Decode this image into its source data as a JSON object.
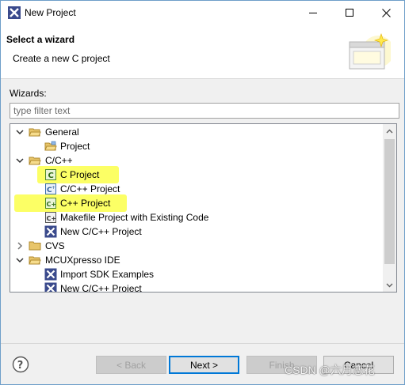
{
  "window": {
    "title": "New Project",
    "controls": [
      "minimize",
      "maximize",
      "close"
    ]
  },
  "banner": {
    "title": "Select a wizard",
    "subtitle": "Create a new C project"
  },
  "wizards": {
    "label": "Wizards:",
    "filter_placeholder": "type filter text",
    "filter_value": "",
    "tree": [
      {
        "label": "General",
        "icon": "folder-open-icon",
        "expanded": true
      },
      {
        "label": "Project",
        "icon": "project-folder-icon"
      },
      {
        "label": "C/C++",
        "icon": "folder-open-icon",
        "expanded": true
      },
      {
        "label": "C Project",
        "icon": "c-project-icon",
        "highlighted": true
      },
      {
        "label": "C/C++ Project",
        "icon": "cpp-project-icon"
      },
      {
        "label": "C++ Project",
        "icon": "cpp-project-icon",
        "highlighted": true
      },
      {
        "label": "Makefile Project with Existing Code",
        "icon": "makefile-project-icon"
      },
      {
        "label": "New C/C++ Project",
        "icon": "x-wizard-icon"
      },
      {
        "label": "CVS",
        "icon": "folder-closed-icon",
        "expanded": false
      },
      {
        "label": "MCUXpresso IDE",
        "icon": "folder-open-icon",
        "expanded": true
      },
      {
        "label": "Import SDK Examples",
        "icon": "x-wizard-icon"
      },
      {
        "label": "New C/C++ Project",
        "icon": "x-wizard-icon"
      }
    ]
  },
  "buttons": {
    "back": "< Back",
    "next": "Next >",
    "finish": "Finish",
    "cancel": "Cancel"
  },
  "watermark": "CSDN @六月恋花",
  "colors": {
    "highlight": "#fcff4a",
    "title_accent": "#6e9ec9",
    "default_button_border": "#0078d7"
  }
}
